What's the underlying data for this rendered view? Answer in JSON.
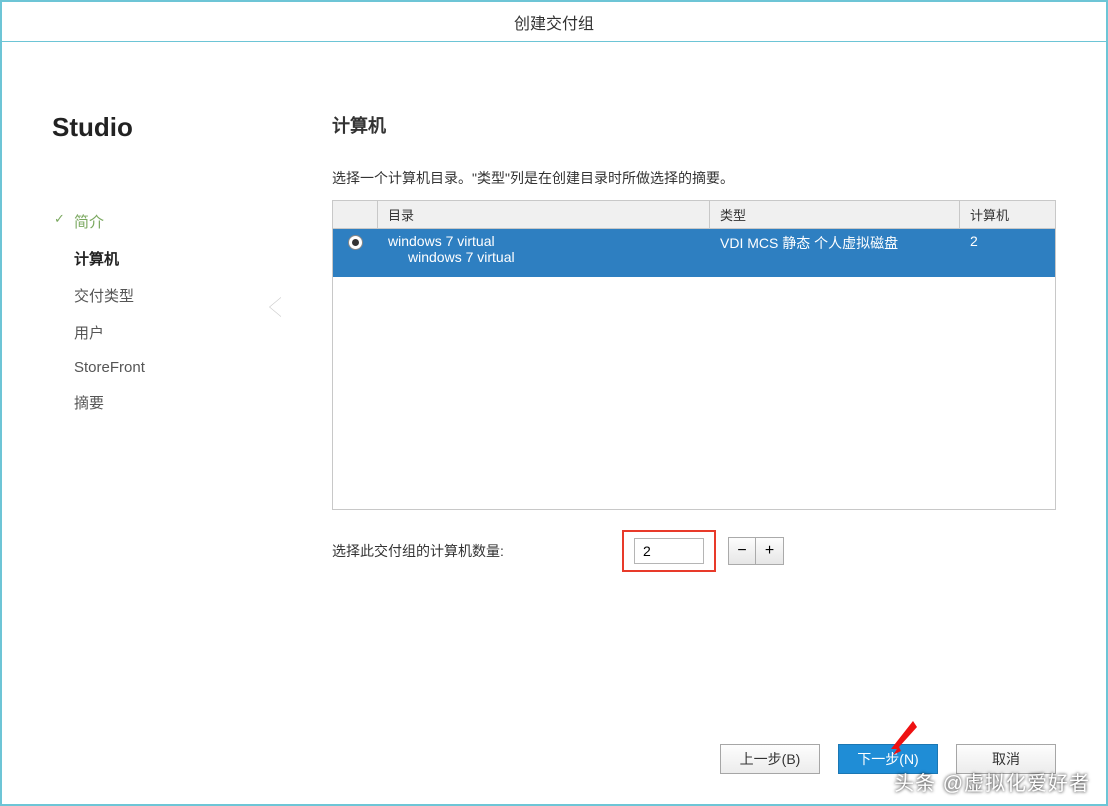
{
  "window": {
    "title": "创建交付组"
  },
  "sidebar": {
    "title": "Studio",
    "items": [
      {
        "label": "简介",
        "state": "completed"
      },
      {
        "label": "计算机",
        "state": "active"
      },
      {
        "label": "交付类型",
        "state": "pending"
      },
      {
        "label": "用户",
        "state": "pending"
      },
      {
        "label": "StoreFront",
        "state": "pending"
      },
      {
        "label": "摘要",
        "state": "pending"
      }
    ]
  },
  "main": {
    "title": "计算机",
    "instruction": "选择一个计算机目录。\"类型\"列是在创建目录时所做选择的摘要。",
    "table": {
      "headers": {
        "dir": "目录",
        "type": "类型",
        "count": "计算机"
      },
      "rows": [
        {
          "selected": true,
          "dir_line1": "windows 7 virtual",
          "dir_line2": "windows 7 virtual",
          "type": "VDI MCS 静态 个人虚拟磁盘",
          "count": "2"
        }
      ]
    },
    "count_section": {
      "label": "选择此交付组的计算机数量:",
      "value": "2",
      "minus": "−",
      "plus": "+"
    },
    "buttons": {
      "back": "上一步(B)",
      "next": "下一步(N)",
      "cancel": "取消"
    }
  },
  "watermark": "头条 @虚拟化爱好者"
}
